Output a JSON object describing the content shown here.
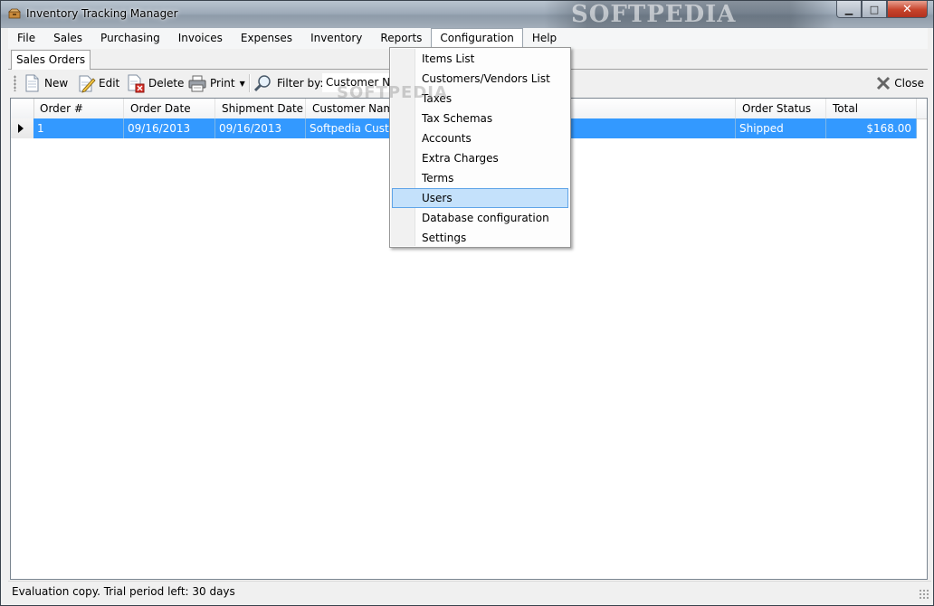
{
  "window": {
    "title": "Inventory Tracking Manager",
    "watermark": "SOFTPEDIA",
    "caption": {
      "minimize": "▁",
      "maximize": "□",
      "close": "✕"
    }
  },
  "menu": [
    "File",
    "Sales",
    "Purchasing",
    "Invoices",
    "Expenses",
    "Inventory",
    "Reports",
    "Configuration",
    "Help"
  ],
  "tab": {
    "label": "Sales Orders"
  },
  "toolbar": {
    "new": "New",
    "edit": "Edit",
    "delete": "Delete",
    "print": "Print",
    "filter_label": "Filter by:",
    "filter_value": "Customer Name",
    "close": "Close"
  },
  "grid": {
    "columns": [
      "Order #",
      "Order Date",
      "Shipment Date",
      "Customer Name",
      "Order Status",
      "Total"
    ],
    "rows": [
      {
        "order_no": "1",
        "order_date": "09/16/2013",
        "shipment_date": "09/16/2013",
        "customer": "Softpedia Customer",
        "status": "Shipped",
        "total": "$168.00"
      }
    ]
  },
  "configuration_menu": {
    "items": [
      "Items List",
      "Customers/Vendors List",
      "Taxes",
      "Tax Schemas",
      "Accounts",
      "Extra Charges",
      "Terms",
      "Users",
      "Database configuration",
      "Settings"
    ],
    "highlighted": "Users"
  },
  "overlay_watermark": "SOFTPEDIA",
  "statusbar": {
    "text": "Evaluation copy. Trial period left: 30 days"
  }
}
